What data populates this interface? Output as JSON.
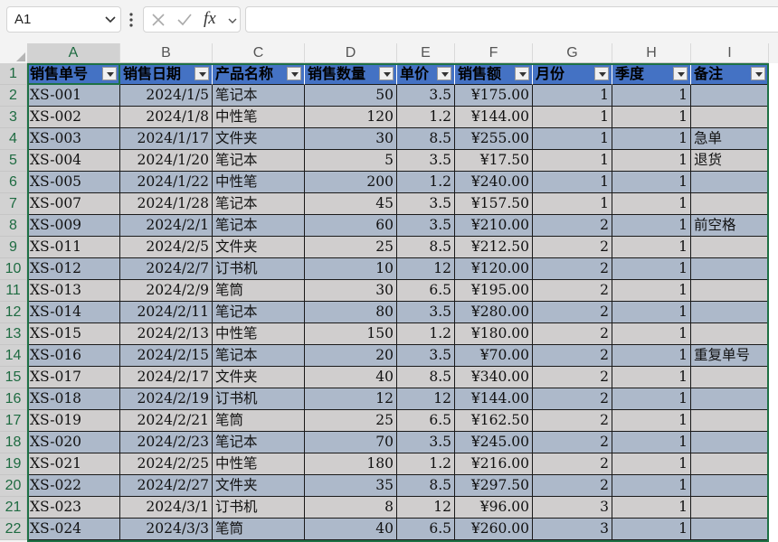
{
  "formula_bar": {
    "name_box": "A1",
    "fx": "fx",
    "formula": ""
  },
  "columns": [
    "A",
    "B",
    "C",
    "D",
    "E",
    "F",
    "G",
    "H",
    "I"
  ],
  "header": [
    "销售单号",
    "销售日期",
    "产品名称",
    "销售数量",
    "单价",
    "销售额",
    "月份",
    "季度",
    "备注"
  ],
  "rows": [
    [
      "XS-001",
      "2024/1/5",
      "笔记本",
      "50",
      "3.5",
      "¥175.00",
      "1",
      "1",
      ""
    ],
    [
      "XS-002",
      "2024/1/8",
      "中性笔",
      "120",
      "1.2",
      "¥144.00",
      "1",
      "1",
      ""
    ],
    [
      "XS-003",
      "2024/1/17",
      "文件夹",
      "30",
      "8.5",
      "¥255.00",
      "1",
      "1",
      "急单"
    ],
    [
      "XS-004",
      "2024/1/20",
      "笔记本",
      "5",
      "3.5",
      "¥17.50",
      "1",
      "1",
      "退货"
    ],
    [
      "XS-005",
      "2024/1/22",
      "中性笔",
      "200",
      "1.2",
      "¥240.00",
      "1",
      "1",
      ""
    ],
    [
      "XS-007",
      "2024/1/28",
      "笔记本",
      "45",
      "3.5",
      "¥157.50",
      "1",
      "1",
      ""
    ],
    [
      "XS-009",
      "2024/2/1",
      "笔记本",
      "60",
      "3.5",
      "¥210.00",
      "2",
      "1",
      "前空格"
    ],
    [
      "XS-011",
      "2024/2/5",
      "文件夹",
      "25",
      "8.5",
      "¥212.50",
      "2",
      "1",
      ""
    ],
    [
      "XS-012",
      "2024/2/7",
      "订书机",
      "10",
      "12",
      "¥120.00",
      "2",
      "1",
      ""
    ],
    [
      "XS-013",
      "2024/2/9",
      "笔筒",
      "30",
      "6.5",
      "¥195.00",
      "2",
      "1",
      ""
    ],
    [
      "XS-014",
      "2024/2/11",
      "笔记本",
      "80",
      "3.5",
      "¥280.00",
      "2",
      "1",
      ""
    ],
    [
      "XS-015",
      "2024/2/13",
      "中性笔",
      "150",
      "1.2",
      "¥180.00",
      "2",
      "1",
      ""
    ],
    [
      "XS-016",
      "2024/2/15",
      "笔记本",
      "20",
      "3.5",
      "¥70.00",
      "2",
      "1",
      "重复单号"
    ],
    [
      "XS-017",
      "2024/2/17",
      "文件夹",
      "40",
      "8.5",
      "¥340.00",
      "2",
      "1",
      ""
    ],
    [
      "XS-018",
      "2024/2/19",
      "订书机",
      "12",
      "12",
      "¥144.00",
      "2",
      "1",
      ""
    ],
    [
      "XS-019",
      "2024/2/21",
      "笔筒",
      "25",
      "6.5",
      "¥162.50",
      "2",
      "1",
      ""
    ],
    [
      "XS-020",
      "2024/2/23",
      "笔记本",
      "70",
      "3.5",
      "¥245.00",
      "2",
      "1",
      ""
    ],
    [
      "XS-021",
      "2024/2/25",
      "中性笔",
      "180",
      "1.2",
      "¥216.00",
      "2",
      "1",
      ""
    ],
    [
      "XS-022",
      "2024/2/27",
      "文件夹",
      "35",
      "8.5",
      "¥297.50",
      "2",
      "1",
      ""
    ],
    [
      "XS-023",
      "2024/3/1",
      "订书机",
      "8",
      "12",
      "¥96.00",
      "3",
      "1",
      ""
    ],
    [
      "XS-024",
      "2024/3/3",
      "笔筒",
      "40",
      "6.5",
      "¥260.00",
      "3",
      "1",
      ""
    ]
  ],
  "row_numbers": [
    "1",
    "2",
    "3",
    "4",
    "5",
    "6",
    "7",
    "8",
    "9",
    "10",
    "11",
    "12",
    "13",
    "14",
    "15",
    "16",
    "17",
    "18",
    "19",
    "20",
    "21",
    "22"
  ],
  "colors": {
    "header_fill": "#4472c4",
    "band_dark": "#adb9ca",
    "band_light": "#d0cece",
    "selection": "#1e7145"
  }
}
